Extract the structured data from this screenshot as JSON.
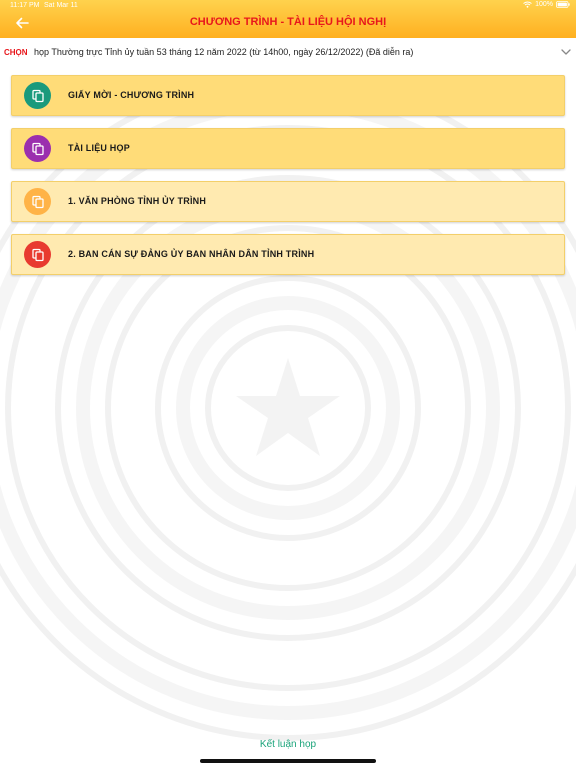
{
  "status_bar": {
    "time": "11:17 PM",
    "date": "Sat Mar 11",
    "battery": "100%"
  },
  "header": {
    "title": "CHƯƠNG TRÌNH - TÀI LIỆU HỘI NGHỊ",
    "back_icon": "arrow-left-icon"
  },
  "selector": {
    "label": "CHỌN",
    "value": "họp Thường trực Tỉnh ủy tuần 53 tháng 12 năm 2022 (từ 14h00, ngày 26/12/2022) (Đã diễn ra)",
    "icon": "chevron-down-icon"
  },
  "items": [
    {
      "label": "GIẤY MỜI - CHƯƠNG TRÌNH",
      "icon": "copy-icon",
      "icon_color": "#1a9a7c"
    },
    {
      "label": "TÀI LIỆU HỌP",
      "icon": "copy-icon",
      "icon_color": "#9b2fae"
    },
    {
      "label": "1. VĂN PHÒNG TỈNH ỦY TRÌNH",
      "icon": "copy-icon",
      "icon_color": "#ffb347"
    },
    {
      "label": "2. BAN CÁN SỰ ĐẢNG ỦY BAN NHÂN DÂN TỈNH TRÌNH",
      "icon": "copy-icon",
      "icon_color": "#e83a30"
    }
  ],
  "bottom_link": "Kết luận họp",
  "colors": {
    "header_top": "#ffd24d",
    "header_bottom": "#ffb020",
    "title_red": "#e8171c",
    "item_bg_strong": "#ffdc78",
    "item_bg_light": "#ffeab0",
    "link_green": "#1aa37a"
  }
}
